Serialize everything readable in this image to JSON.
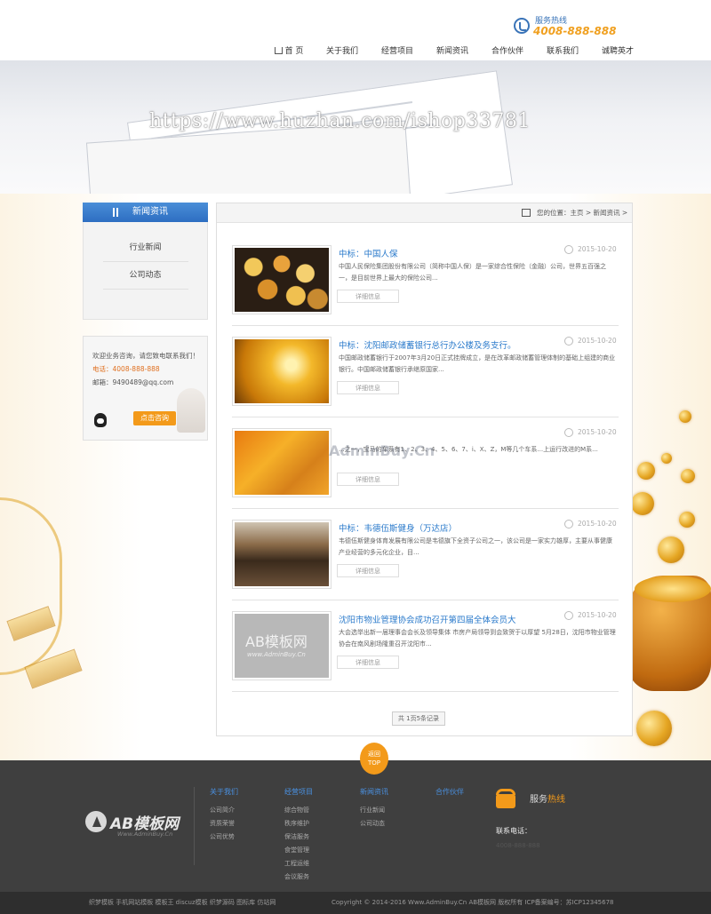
{
  "hotline": {
    "label": "服务热线",
    "number": "4008-888-888"
  },
  "nav": [
    {
      "label": "首 页",
      "icon": "home-icon"
    },
    {
      "label": "关于我们"
    },
    {
      "label": "经营项目"
    },
    {
      "label": "新闻资讯"
    },
    {
      "label": "合作伙伴"
    },
    {
      "label": "联系我们"
    },
    {
      "label": "诚聘英才"
    }
  ],
  "banner": {
    "watermark": "https://www.huzhan.com/ishop33781"
  },
  "sidebar": {
    "title": "新闻资讯",
    "items": [
      {
        "label": "行业新闻"
      },
      {
        "label": "公司动态"
      }
    ],
    "contact": {
      "intro": "欢迎业务咨询，请您致电联系我们！",
      "tel": "电话：4008-888-888",
      "email": "邮箱：9490489@qq.com",
      "button": "点击咨询"
    }
  },
  "breadcrumb": "您的位置：主页 > 新闻资讯 >",
  "news": [
    {
      "title": "中标：中国人保",
      "date": "2015-10-20",
      "desc": "中国人民保险集团股份有限公司（简称中国人保）是一家综合性保险（金融）公司，世界五百强之一，是目前世界上最大的保险公司...",
      "more": "详细信息"
    },
    {
      "title": "中标：沈阳邮政储蓄银行总行办公楼及务支行。",
      "date": "2015-10-20",
      "desc": "中国邮政储蓄银行于2007年3月20日正式挂牌成立，是在改革邮政储蓄管理体制的基础上组建的商业银行。中国邮政储蓄银行承继原国家...",
      "more": "详细信息"
    },
    {
      "title": "",
      "date": "2015-10-20",
      "desc": "...之一，宝马的车系有1、2、3、4、5、6、7、i、X、Z，M等几个车系...上运行改进的M系...",
      "more": "详细信息"
    },
    {
      "title": "中标：韦德伍斯健身（万达店）",
      "date": "2015-10-20",
      "desc": "韦德伍斯健身体育发展有限公司是韦德旗下全资子公司之一，该公司是一家实力雄厚，主要从事健康产业经营的多元化企业，目...",
      "more": "详细信息"
    },
    {
      "title": "沈阳市物业管理协会成功召开第四届全体会员大",
      "date": "2015-10-20",
      "desc": "大会选举出新一届理事会会长及领导集体 市房产局领导到会致贺于以厚望 5月28日，沈阳市物业管理协会在南风剧场隆重召开沈阳市...",
      "more": "详细信息",
      "thumb_text": "AB模板网",
      "thumb_sub": "www.AdminBuy.Cn"
    }
  ],
  "overlay_watermark": "AdminBuy.Cn",
  "pager": "共 1页5条记录",
  "to_top": {
    "line1": "返回",
    "line2": "TOP"
  },
  "footer": {
    "logo": {
      "name": "AB模板网",
      "sub": "Www.AdminBuy.Cn"
    },
    "columns": [
      {
        "title": "关于我们",
        "links": [
          "公司简介",
          "资质荣誉",
          "公司优势"
        ]
      },
      {
        "title": "经营项目",
        "links": [
          "综合物管",
          "秩序维护",
          "保洁服务",
          "食堂管理",
          "工程运维",
          "会议服务"
        ]
      },
      {
        "title": "新闻资讯",
        "links": [
          "行业新闻",
          "公司动态"
        ]
      },
      {
        "title": "合作伙伴",
        "links": []
      }
    ],
    "hotline_prefix": "服务",
    "hotline_suffix": "热线",
    "tel_label": "联系电话：",
    "tel_number": "4008-888-888"
  },
  "bottom": {
    "links": "织梦模板  手机网站模板  模板王  discuz模板  织梦源码  图标库  仿站网",
    "copyright": "Copyright © 2014-2016 Www.AdminBuy.Cn AB模板网 版权所有  ICP备案编号：苏ICP12345678"
  },
  "colors": {
    "accent_blue": "#2a7acb",
    "accent_orange": "#f39a1a",
    "footer_bg": "#3f3f3f"
  }
}
